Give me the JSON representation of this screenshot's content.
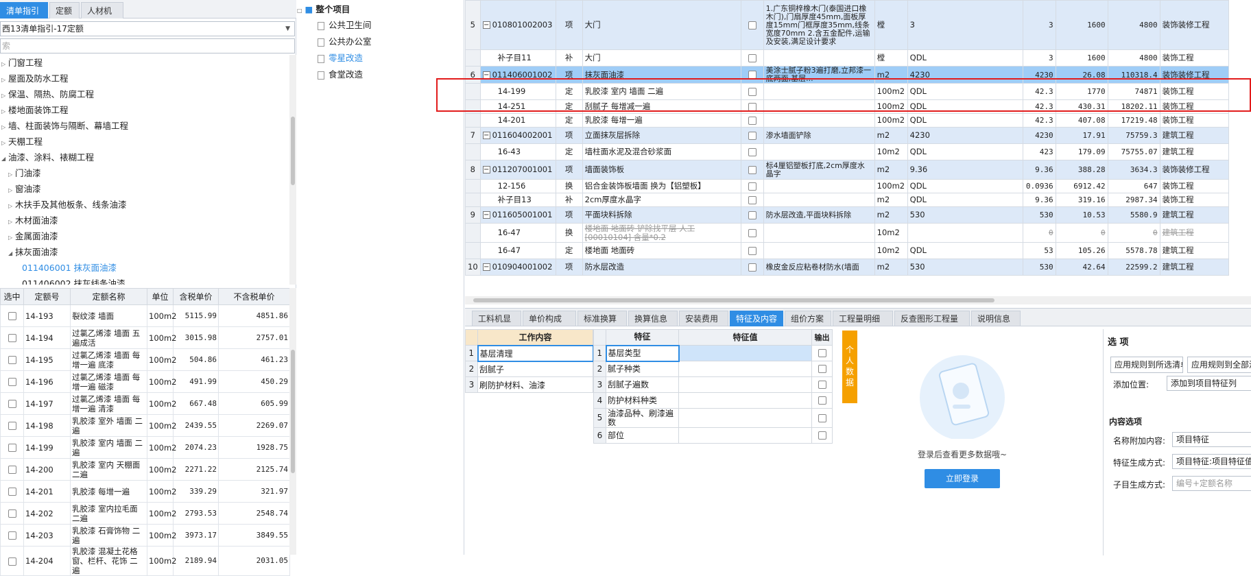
{
  "left": {
    "tabs": [
      "清单指引",
      "定额",
      "人材机"
    ],
    "combo_value": "西13清单指引-17定额",
    "search_placeholder": "索",
    "tree": [
      {
        "label": "门窗工程",
        "level": 0,
        "state": "closed"
      },
      {
        "label": "屋面及防水工程",
        "level": 0,
        "state": "closed"
      },
      {
        "label": "保温、隔热、防腐工程",
        "level": 0,
        "state": "closed"
      },
      {
        "label": "楼地面装饰工程",
        "level": 0,
        "state": "closed"
      },
      {
        "label": "墙、柱面装饰与隔断、幕墙工程",
        "level": 0,
        "state": "closed"
      },
      {
        "label": "天棚工程",
        "level": 0,
        "state": "closed"
      },
      {
        "label": "油漆、涂料、裱糊工程",
        "level": 0,
        "state": "open"
      },
      {
        "label": "门油漆",
        "level": 1,
        "state": "closed"
      },
      {
        "label": "窗油漆",
        "level": 1,
        "state": "closed"
      },
      {
        "label": "木扶手及其他板条、线条油漆",
        "level": 1,
        "state": "closed"
      },
      {
        "label": "木材面油漆",
        "level": 1,
        "state": "closed"
      },
      {
        "label": "金属面油漆",
        "level": 1,
        "state": "closed"
      },
      {
        "label": "抹灰面油漆",
        "level": 1,
        "state": "open"
      },
      {
        "label": "011406001   抹灰面油漆",
        "level": 2,
        "state": "leaf",
        "highlight": true
      },
      {
        "label": "011406002   抹灰线条油漆",
        "level": 2,
        "state": "leaf"
      }
    ],
    "grid_headers": [
      "选中",
      "定额号",
      "定额名称",
      "单位",
      "含税单价",
      "不含税单价"
    ],
    "grid_rows": [
      {
        "code": "14-193",
        "name": "裂纹漆 墙面",
        "unit": "100m2",
        "tax": "5115.99",
        "notax": "4851.86"
      },
      {
        "code": "14-194",
        "name": "过氯乙烯漆 墙面 五遍成活",
        "unit": "100m2",
        "tax": "3015.98",
        "notax": "2757.01"
      },
      {
        "code": "14-195",
        "name": "过氯乙烯漆 墙面 每增一遍 底漆",
        "unit": "100m2",
        "tax": "504.86",
        "notax": "461.23"
      },
      {
        "code": "14-196",
        "name": "过氯乙烯漆 墙面 每增一遍 磁漆",
        "unit": "100m2",
        "tax": "491.99",
        "notax": "450.29"
      },
      {
        "code": "14-197",
        "name": "过氯乙烯漆 墙面 每增一遍 清漆",
        "unit": "100m2",
        "tax": "667.48",
        "notax": "605.99"
      },
      {
        "code": "14-198",
        "name": "乳胶漆 室外 墙面 二遍",
        "unit": "100m2",
        "tax": "2439.55",
        "notax": "2269.07"
      },
      {
        "code": "14-199",
        "name": "乳胶漆 室内 墙面 二遍",
        "unit": "100m2",
        "tax": "2074.23",
        "notax": "1928.75"
      },
      {
        "code": "14-200",
        "name": "乳胶漆 室内 天棚面 二遍",
        "unit": "100m2",
        "tax": "2271.22",
        "notax": "2125.74"
      },
      {
        "code": "14-201",
        "name": "乳胶漆 每增一遍",
        "unit": "100m2",
        "tax": "339.29",
        "notax": "321.97"
      },
      {
        "code": "14-202",
        "name": "乳胶漆 室内拉毛面 二遍",
        "unit": "100m2",
        "tax": "2793.53",
        "notax": "2548.74"
      },
      {
        "code": "14-203",
        "name": "乳胶漆 石膏饰物 二遍",
        "unit": "100m2",
        "tax": "3973.17",
        "notax": "3849.55"
      },
      {
        "code": "14-204",
        "name": "乳胶漆 混凝土花格窗、栏杆、花饰 二遍",
        "unit": "100m2",
        "tax": "2189.94",
        "notax": "2031.05"
      }
    ]
  },
  "middle": {
    "root": "整个项目",
    "items": [
      "公共卫生间",
      "公共办公室",
      "零星改造",
      "食堂改造"
    ]
  },
  "main_rows": [
    {
      "num": "5",
      "minus": true,
      "code": "010801002003",
      "type": "项",
      "name": "大门",
      "feat": "1.广东铜梓橡木门(泰国进口橡木门),门扇厚度45mm,面板厚度15mm门框厚度35mm,线条宽度70mm 2.含五金配件,运输及安装,满足设计要求",
      "unit": "樘",
      "qtyexp": "3",
      "qty": "3",
      "price": "1600",
      "total": "4800",
      "prof": "装饰装修工程",
      "kind": "q",
      "h": 72
    },
    {
      "num": "",
      "minus": false,
      "code": "补子目11",
      "type": "补",
      "name": "大门",
      "feat": "",
      "unit": "樘",
      "qtyexp": "QDL",
      "qty": "3",
      "price": "1600",
      "total": "4800",
      "prof": "装饰工程",
      "kind": "d",
      "h": 24
    },
    {
      "num": "6",
      "minus": true,
      "code": "011406001002",
      "type": "项",
      "name": "抹灰面油漆",
      "feat": "美涂士腻子粉3遍打磨,立邦漆一底两面,基层...",
      "unit": "m2",
      "qtyexp": "4230",
      "qty": "4230",
      "price": "26.08",
      "total": "110318.4",
      "prof": "装饰装修工程",
      "kind": "sel",
      "h": 24
    },
    {
      "num": "",
      "minus": false,
      "code": "14-199",
      "type": "定",
      "name": "乳胶漆 室内 墙面 二遍",
      "feat": "",
      "unit": "100m2",
      "qtyexp": "QDL",
      "qty": "42.3",
      "price": "1770",
      "total": "74871",
      "prof": "装饰工程",
      "kind": "d",
      "h": 24
    },
    {
      "num": "",
      "minus": false,
      "code": "14-251",
      "type": "定",
      "name": "刮腻子 每增减一遍",
      "feat": "",
      "unit": "100m2",
      "qtyexp": "QDL",
      "qty": "42.3",
      "price": "430.31",
      "total": "18202.11",
      "prof": "装饰工程",
      "kind": "d",
      "h": 20
    },
    {
      "num": "",
      "minus": false,
      "code": "14-201",
      "type": "定",
      "name": "乳胶漆 每增一遍",
      "feat": "",
      "unit": "100m2",
      "qtyexp": "QDL",
      "qty": "42.3",
      "price": "407.08",
      "total": "17219.48",
      "prof": "装饰工程",
      "kind": "d",
      "h": 20
    },
    {
      "num": "7",
      "minus": true,
      "code": "011604002001",
      "type": "项",
      "name": "立面抹灰层拆除",
      "feat": "渗水墙面铲除",
      "unit": "m2",
      "qtyexp": "4230",
      "qty": "4230",
      "price": "17.91",
      "total": "75759.3",
      "prof": "建筑工程",
      "kind": "q",
      "h": 24
    },
    {
      "num": "",
      "minus": false,
      "code": "16-43",
      "type": "定",
      "name": "墙柱面水泥及混合砂浆面",
      "feat": "",
      "unit": "10m2",
      "qtyexp": "QDL",
      "qty": "423",
      "price": "179.09",
      "total": "75755.07",
      "prof": "建筑工程",
      "kind": "d",
      "h": 24
    },
    {
      "num": "8",
      "minus": true,
      "code": "011207001001",
      "type": "项",
      "name": "墙面装饰板",
      "feat": "标4厘铝塑板打底,2cm厚度水晶字",
      "unit": "m2",
      "qtyexp": "9.36",
      "qty": "9.36",
      "price": "388.28",
      "total": "3634.3",
      "prof": "装饰装修工程",
      "kind": "q",
      "h": 28
    },
    {
      "num": "",
      "minus": false,
      "code": "12-156",
      "type": "换",
      "name": "铝合金装饰板墙面 换为【铝塑板】",
      "feat": "",
      "unit": "100m2",
      "qtyexp": "QDL",
      "qty": "0.0936",
      "price": "6912.42",
      "total": "647",
      "prof": "装饰工程",
      "kind": "d",
      "h": 20
    },
    {
      "num": "",
      "minus": false,
      "code": "补子目13",
      "type": "补",
      "name": "2cm厚度水晶字",
      "feat": "",
      "unit": "m2",
      "qtyexp": "QDL",
      "qty": "9.36",
      "price": "319.16",
      "total": "2987.34",
      "prof": "装饰工程",
      "kind": "d",
      "h": 20
    },
    {
      "num": "9",
      "minus": true,
      "code": "011605001001",
      "type": "项",
      "name": "平面块料拆除",
      "feat": "防水层改造,平面块料拆除",
      "unit": "m2",
      "qtyexp": "530",
      "qty": "530",
      "price": "10.53",
      "total": "5580.9",
      "prof": "建筑工程",
      "kind": "q",
      "h": 24
    },
    {
      "num": "",
      "minus": false,
      "code": "16-47",
      "type": "换",
      "name": "楼地面 地面砖 铲除找平层 人工[00010104] 含量*0.2",
      "feat": "",
      "unit": "10m2",
      "qtyexp": "",
      "qty": "0",
      "price": "0",
      "total": "0",
      "prof": "建筑工程",
      "kind": "strike",
      "h": 28
    },
    {
      "num": "",
      "minus": false,
      "code": "16-47",
      "type": "定",
      "name": "楼地面 地面砖",
      "feat": "",
      "unit": "10m2",
      "qtyexp": "QDL",
      "qty": "53",
      "price": "105.26",
      "total": "5578.78",
      "prof": "建筑工程",
      "kind": "d",
      "h": 24
    },
    {
      "num": "10",
      "minus": true,
      "code": "010904001002",
      "type": "项",
      "name": "防水层改造",
      "feat": "橡皮金反应粘卷材防水(墙面",
      "unit": "m2",
      "qtyexp": "530",
      "qty": "530",
      "price": "42.64",
      "total": "22599.2",
      "prof": "建筑工程",
      "kind": "q",
      "h": 24
    }
  ],
  "bottom": {
    "tabs": [
      "工料机显示",
      "单价构成",
      "标准换算",
      "换算信息",
      "安装费用",
      "特征及内容",
      "组价方案",
      "工程量明细",
      "反查图形工程量",
      "说明信息"
    ],
    "active_tab": "特征及内容",
    "work_header": "工作内容",
    "work_items": [
      "基层清理",
      "刮腻子",
      "刷防护材料、油漆"
    ],
    "feat_headers": [
      "特征",
      "特征值",
      "输出"
    ],
    "feat_items": [
      "基层类型",
      "腻子种类",
      "刮腻子遍数",
      "防护材料种类",
      "油漆品种、刷漆遍数",
      "部位"
    ],
    "personal_label": "个人数据",
    "login_text": "登录后查看更多数据哦~",
    "login_button": "立即登录",
    "options": {
      "title": "选 项",
      "apply_selected": "应用规则到所选清单",
      "apply_all": "应用规则到全部清单",
      "add_position_label": "添加位置:",
      "add_position_value": "添加到项目特征列",
      "content_title": "内容选项",
      "name_append_label": "名称附加内容:",
      "name_append_value": "项目特征",
      "feature_gen_label": "特征生成方式:",
      "feature_gen_value": "项目特征:项目特征值",
      "child_gen_label": "子目生成方式:",
      "child_gen_value": "编号+定额名称"
    }
  },
  "colors": {
    "accent": "#2f8de4",
    "selected_row": "#9fcdf7",
    "list_row": "#dde9f8",
    "highlight_box": "#e21b1b",
    "personal": "#f5a000"
  }
}
